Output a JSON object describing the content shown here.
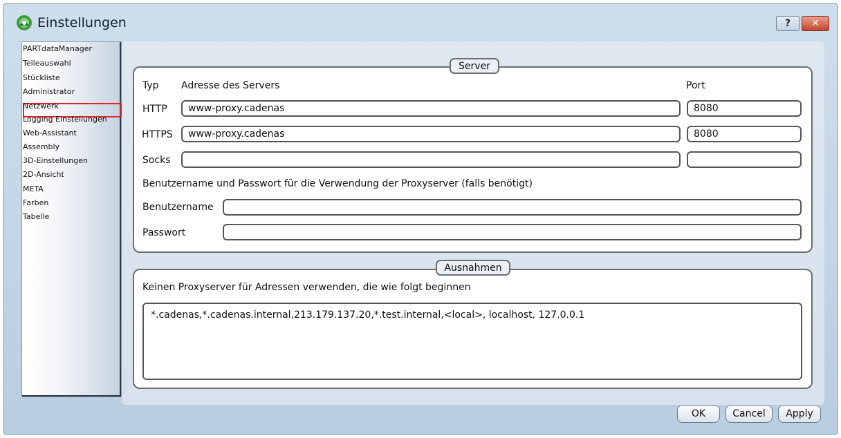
{
  "window": {
    "title": "Einstellungen"
  },
  "titlebar": {
    "help_label": "?",
    "close_label": "✕"
  },
  "sidebar": {
    "items": [
      {
        "label": "PARTdataManager"
      },
      {
        "label": "Teileauswahl"
      },
      {
        "label": "Stückliste"
      },
      {
        "label": "Administrator"
      },
      {
        "label": "Netzwerk",
        "selected": true
      },
      {
        "label": "Logging Einstellungen"
      },
      {
        "label": "Web-Assistant"
      },
      {
        "label": "Assembly"
      },
      {
        "label": "3D-Einstellungen"
      },
      {
        "label": "2D-Ansicht"
      },
      {
        "label": "META"
      },
      {
        "label": "Farben"
      },
      {
        "label": "Tabelle"
      }
    ]
  },
  "server": {
    "legend": "Server",
    "col_type": "Typ",
    "col_address": "Adresse des Servers",
    "col_port": "Port",
    "http_label": "HTTP",
    "http_address": "www-proxy.cadenas",
    "http_port": "8080",
    "https_label": "HTTPS",
    "https_address": "www-proxy.cadenas",
    "https_port": "8080",
    "socks_label": "Socks",
    "socks_address": "",
    "socks_port": "",
    "auth_note": "Benutzername und Passwort für die Verwendung der Proxyserver (falls benötigt)",
    "username_label": "Benutzername",
    "username_value": "",
    "password_label": "Passwort",
    "password_value": ""
  },
  "exceptions": {
    "legend": "Ausnahmen",
    "description": "Keinen Proxyserver für Adressen verwenden, die wie folgt beginnen",
    "value": "*.cadenas,*.cadenas.internal,213.179.137.20,*.test.internal,<local>, localhost, 127.0.0.1"
  },
  "buttons": {
    "ok": "OK",
    "cancel": "Cancel",
    "apply": "Apply"
  },
  "colors": {
    "highlight": "#e0242a",
    "window_bg": "#c6d6e6"
  }
}
